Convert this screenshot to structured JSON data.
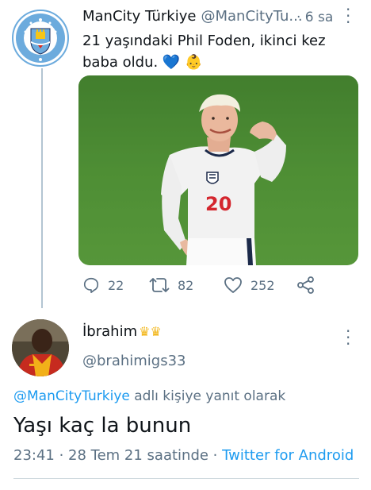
{
  "original_tweet": {
    "display_name": "ManCity Türkiye",
    "handle": "@ManCityTu...",
    "time": "· 6 sa",
    "text": "21 yaşındaki Phil Foden, ikinci kez baba oldu. 💙 👶",
    "actions": {
      "replies": "22",
      "retweets": "82",
      "likes": "252"
    }
  },
  "reply_tweet": {
    "display_name": "İbrahim",
    "handle": "@brahimigs33",
    "reply_prefix": "@ManCityTurkiye",
    "reply_suffix": " adlı kişiye yanıt olarak",
    "text": "Yaşı kaç la bunun",
    "time": "23:41 · 28 Tem 21 saatinde · ",
    "source": "Twitter for Android"
  },
  "colors": {
    "link": "#1d9bf0",
    "secondary_text": "#5b7083",
    "city_blue": "#6cabdd"
  }
}
